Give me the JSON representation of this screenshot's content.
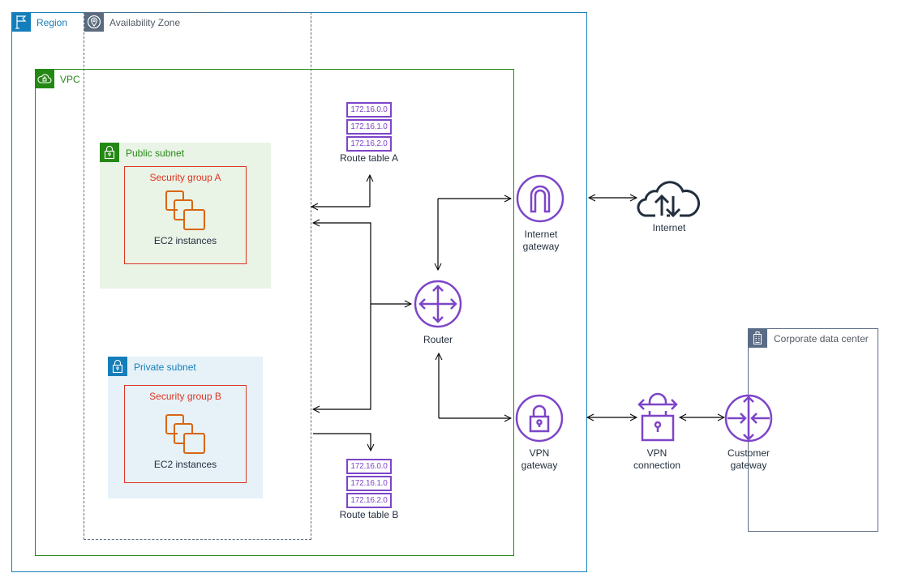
{
  "groups": {
    "region": "Region",
    "availability_zone": "Availability Zone",
    "vpc": "VPC",
    "public_subnet": "Public subnet",
    "private_subnet": "Private subnet",
    "security_group_a": "Security group A",
    "security_group_b": "Security group B",
    "corporate_data_center": "Corporate data center"
  },
  "nodes": {
    "ec2_a": "EC2 instances",
    "ec2_b": "EC2 instances",
    "route_table_a": {
      "label": "Route table A",
      "routes": [
        "172.16.0.0",
        "172.16.1.0",
        "172.16.2.0"
      ]
    },
    "route_table_b": {
      "label": "Route table B",
      "routes": [
        "172.16.0.0",
        "172.16.1.0",
        "172.16.2.0"
      ]
    },
    "router": "Router",
    "internet_gateway": [
      "Internet",
      "gateway"
    ],
    "internet": "Internet",
    "vpn_gateway": [
      "VPN",
      "gateway"
    ],
    "vpn_connection": [
      "VPN",
      "connection"
    ],
    "customer_gateway": [
      "Customer",
      "gateway"
    ]
  },
  "colors": {
    "region": "#147eba",
    "vpc": "#248814",
    "availability_zone": "#5a6b7e",
    "public_subnet_bg": "#e9f3e6",
    "private_subnet_bg": "#e6f2f8",
    "security_group": "#dd3522",
    "ec2": "#d86613",
    "network_icon": "#7d45c8",
    "corporate": "#5a6b86"
  }
}
